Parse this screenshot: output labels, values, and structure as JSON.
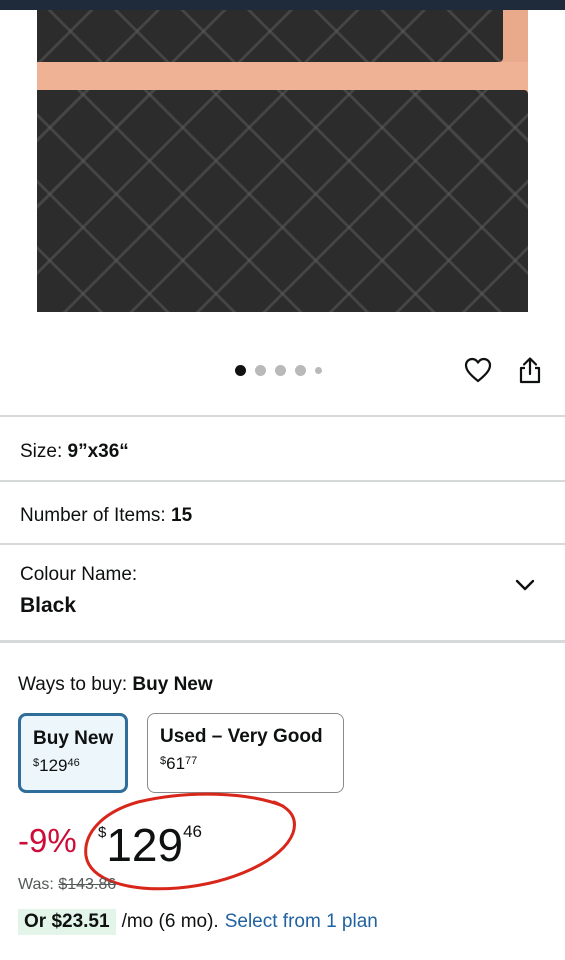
{
  "colors": {
    "accent": "#2f6e9a",
    "discount": "#cc0c39",
    "link": "#2162a1",
    "annotation": "#d8261a"
  },
  "gallery": {
    "dot_count": 5,
    "active_index": 0
  },
  "icons": {
    "wishlist": "heart-icon",
    "share": "share-icon",
    "expand": "chevron-down-icon"
  },
  "variations": {
    "size_label": "Size:",
    "size_value": "9”x36“",
    "items_label": "Number of Items:",
    "items_value": "15",
    "colour_label": "Colour Name:",
    "colour_value": "Black"
  },
  "buying": {
    "ways_label": "Ways to buy:",
    "ways_value": "Buy New",
    "options": [
      {
        "title": "Buy New",
        "currency": "$",
        "whole": "129",
        "fraction": "46",
        "selected": true
      },
      {
        "title": "Used – Very Good",
        "currency": "$",
        "whole": "61",
        "fraction": "77",
        "selected": false
      }
    ]
  },
  "price": {
    "discount": "-9%",
    "currency": "$",
    "whole": "129",
    "fraction": "46",
    "was_label": "Was:",
    "was_value": "$143.86"
  },
  "installment": {
    "amount": "Or $23.51",
    "terms": "/mo (6 mo).",
    "link": "Select from 1 plan"
  }
}
